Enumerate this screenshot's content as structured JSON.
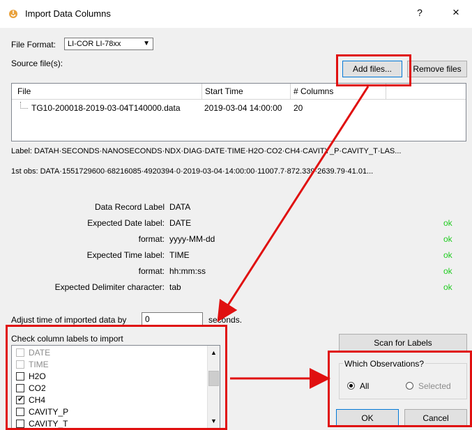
{
  "window": {
    "title": "Import Data Columns",
    "help": "?",
    "close": "×"
  },
  "file_format": {
    "label": "File Format:",
    "value": "LI-COR LI-78xx"
  },
  "source_files": {
    "label": "Source file(s):",
    "add_button": "Add files...",
    "remove_button": "Remove files",
    "columns": [
      "File",
      "Start Time",
      "# Columns"
    ],
    "rows": [
      {
        "file": "TG10-200018-2019-03-04T140000.data",
        "start_time": "2019-03-04 14:00:00",
        "columns": "20"
      }
    ]
  },
  "preview": {
    "label_line": "Label:  DATAH·SECONDS·NANOSECONDS·NDX·DIAG·DATE·TIME·H2O·CO2·CH4·CAVITY_P·CAVITY_T·LAS...",
    "obs_line": "1st obs:  DATA·1551729600·68216085·4920394·0·2019-03-04·14:00:00·11007.7·872.339·2639.79·41.01..."
  },
  "expected": [
    {
      "label": "Data Record Label",
      "value": "DATA",
      "status": ""
    },
    {
      "label": "Expected Date label:",
      "value": "DATE",
      "status": "ok"
    },
    {
      "label": "format:",
      "value": "yyyy-MM-dd",
      "status": "ok"
    },
    {
      "label": "Expected Time label:",
      "value": "TIME",
      "status": "ok"
    },
    {
      "label": "format:",
      "value": "hh:mm:ss",
      "status": "ok"
    },
    {
      "label": "Expected Delimiter character:",
      "value": "tab",
      "status": "ok"
    }
  ],
  "adjust": {
    "label": "Adjust time of imported data by",
    "value": "0",
    "unit": "seconds."
  },
  "labels_list": {
    "title": "Check column labels to import",
    "items": [
      {
        "label": "DATE",
        "checked": false,
        "disabled": true
      },
      {
        "label": "TIME",
        "checked": false,
        "disabled": true
      },
      {
        "label": "H2O",
        "checked": false,
        "disabled": false
      },
      {
        "label": "CO2",
        "checked": false,
        "disabled": false
      },
      {
        "label": "CH4",
        "checked": true,
        "disabled": false
      },
      {
        "label": "CAVITY_P",
        "checked": false,
        "disabled": false
      },
      {
        "label": "CAVITY_T",
        "checked": false,
        "disabled": false
      }
    ]
  },
  "scan_button": "Scan for Labels",
  "observations": {
    "title": "Which Observations?",
    "all": "All",
    "selected": "Selected",
    "selected_option": "All"
  },
  "ok_button": "OK",
  "cancel_button": "Cancel",
  "colors": {
    "annotation_red": "#e01010",
    "ok_green": "#22cc22",
    "accent": "#0078d7"
  }
}
